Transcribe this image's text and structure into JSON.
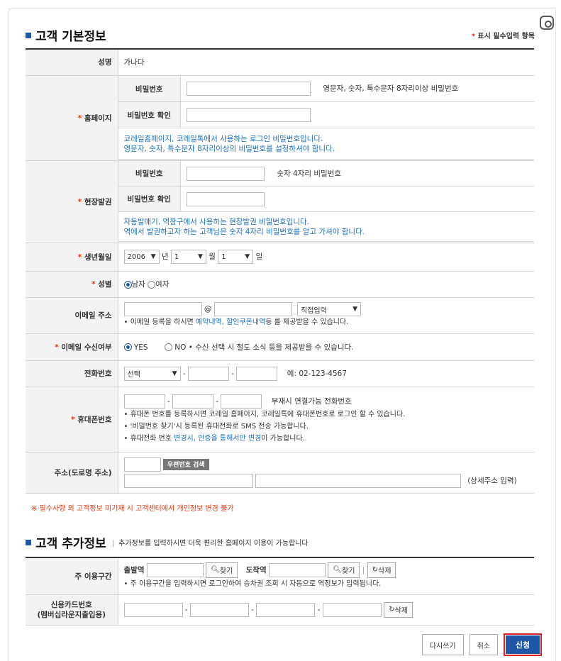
{
  "section1": {
    "title": "고객 기본정보",
    "required_note": "표시 필수입력 항목",
    "name_label": "성명",
    "name_value": "가나다",
    "homepage_label": "홈페이지",
    "homepage_pw_label": "비밀번호",
    "homepage_pw_hint": "영문자, 숫자, 특수문자 8자리이상 비밀번호",
    "homepage_pw_confirm_label": "비밀번호 확인",
    "homepage_note_1": "코레일홈페이지, 코레일톡에서 사용하는 로그인 비밀번호입니다.",
    "homepage_note_2": "영문자, 숫자, 특수문자 8자리이상의 비밀번호를 설정하셔야 합니다.",
    "onsite_label": "현장발권",
    "onsite_pw_label": "비밀번호",
    "onsite_pw_hint": "숫자 4자리 비밀번호",
    "onsite_pw_confirm_label": "비밀번호 확인",
    "onsite_note_1": "자동발매기, 역창구에서 사용하는 현장발권 비밀번호입니다.",
    "onsite_note_2": "역에서 발권하고자 하는 고객님은 숫자 4자리 비밀번호를 알고 가셔야 합니다.",
    "birth_label": "생년월일",
    "birth_year": "2006",
    "birth_year_unit": "년",
    "birth_month": "1",
    "birth_month_unit": "월",
    "birth_day": "1",
    "birth_day_unit": "일",
    "gender_label": "성별",
    "gender_male": "남자",
    "gender_female": "여자",
    "email_label": "이메일 주소",
    "email_at": "@",
    "email_domain_select": "직접입력",
    "email_note_pre": "이메일 등록을 하시면 ",
    "email_note_link": "예약내역, 할인쿠폰내역",
    "email_note_post": "등 를 제공받을 수 있습니다.",
    "email_recv_label": "이메일 수신여부",
    "email_recv_yes": "YES",
    "email_recv_no": "NO",
    "email_recv_note": "• 수신 선택 시 철도 소식 등을 제공받을 수 있습니다.",
    "phone_label": "전화번호",
    "phone_select": "선택",
    "phone_example": "예: 02-123-4567",
    "mobile_label": "휴대폰번호",
    "mobile_hint": "부재시 연결가능 전화번호",
    "mobile_note_1": "휴대폰 번호를 등록하시면 코레일 홈페이지, 코레일톡에 휴대폰번호로 로그인 할 수 있습니다.",
    "mobile_note_2": "'비밀번호 찾기'시 등록된 휴대전화로 SMS 전송 가능합니다.",
    "mobile_note_3_pre": "휴대전화 번호 ",
    "mobile_note_3_link": "변경시, 인증을 통해서만 변경",
    "mobile_note_3_post": "이 가능합니다.",
    "address_label": "주소(도로명 주소)",
    "zip_button": "우편번호 검색",
    "address_detail_hint": "(상세주소 입력)"
  },
  "warning": "※ 필수사항 외 고객정보 미기재 시 고객센터에서 개인정보 변경 불가",
  "section2": {
    "title": "고객 추가정보",
    "subtitle": "추가정보를 입력하시면 더욱 편리한 홈페이지 이용이 가능합니다",
    "route_label": "주 이용구간",
    "departure_label": "출발역",
    "arrival_label": "도착역",
    "find_button": "찾기",
    "delete_button": "삭제",
    "route_note": "주 이용구간을 입력하시면 로그인하여 승차권 조회 시 자동으로 역정보가 입력됩니다.",
    "card_label_1": "신용카드번호",
    "card_label_2": "(멤버십라운지출입용)"
  },
  "buttons": {
    "rewrite": "다시쓰기",
    "cancel": "취소",
    "submit": "신청"
  }
}
